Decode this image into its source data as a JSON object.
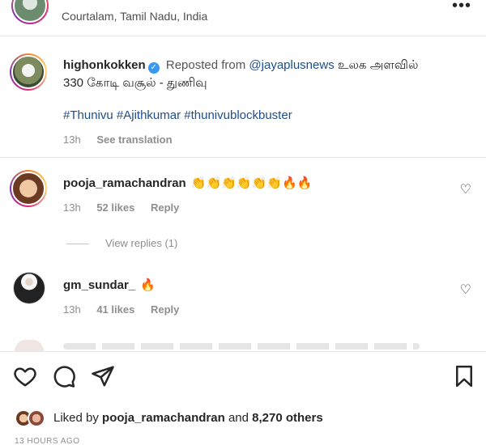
{
  "header": {
    "location": "Courtalam, Tamil Nadu, India",
    "more_icon": "ellipsis-icon"
  },
  "caption": {
    "username": "highonkokken",
    "verified": true,
    "reposted_prefix": "Reposted from",
    "reposted_mention": "@jayaplusnews",
    "text": " உலக அளவில் 330 கோடி வசூல் - துணிவு",
    "hashtags": [
      "#Thunivu",
      "#Ajithkumar",
      "#thunivublockbuster"
    ],
    "time": "13h",
    "see_translation": "See translation"
  },
  "comments": [
    {
      "username": "pooja_ramachandran",
      "emojis": "👏👏👏👏👏👏🔥🔥",
      "time": "13h",
      "likes": "52 likes",
      "reply": "Reply",
      "view_replies": "View replies (1)"
    },
    {
      "username": "gm_sundar_",
      "emojis": "🔥",
      "time": "13h",
      "likes": "41 likes",
      "reply": "Reply"
    }
  ],
  "actions": {
    "like_icon": "heart-icon",
    "comment_icon": "comment-icon",
    "share_icon": "send-icon",
    "save_icon": "bookmark-icon"
  },
  "likes_summary": {
    "prefix": "Liked by",
    "user": "pooja_ramachandran",
    "connector": "and",
    "others": "8,270 others"
  },
  "timestamp": "13 HOURS AGO",
  "colors": {
    "link": "#1f4e8c",
    "verified": "#3897f0",
    "muted": "#8e8e8e"
  }
}
